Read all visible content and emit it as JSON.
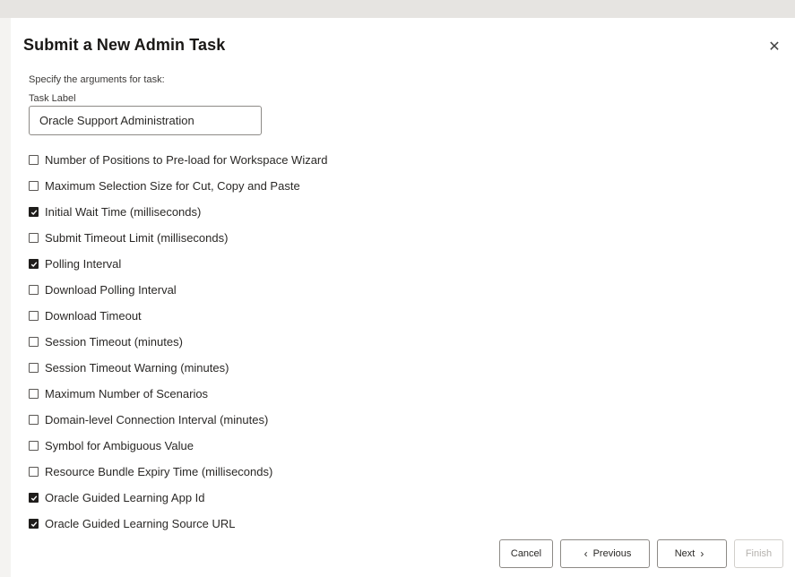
{
  "dialog": {
    "title": "Submit a New Admin Task",
    "close_icon": "close-icon",
    "instructions": "Specify the arguments for task:",
    "task_label": {
      "label": "Task Label",
      "value": "Oracle Support Administration"
    }
  },
  "options": [
    {
      "label": "Number of Positions to Pre-load for Workspace Wizard",
      "checked": false
    },
    {
      "label": "Maximum Selection Size for Cut, Copy and Paste",
      "checked": false
    },
    {
      "label": "Initial Wait Time (milliseconds)",
      "checked": true
    },
    {
      "label": "Submit Timeout Limit (milliseconds)",
      "checked": false
    },
    {
      "label": "Polling Interval",
      "checked": true
    },
    {
      "label": "Download Polling Interval",
      "checked": false
    },
    {
      "label": "Download Timeout",
      "checked": false
    },
    {
      "label": "Session Timeout (minutes)",
      "checked": false
    },
    {
      "label": "Session Timeout Warning (minutes)",
      "checked": false
    },
    {
      "label": "Maximum Number of Scenarios",
      "checked": false
    },
    {
      "label": "Domain-level Connection Interval (minutes)",
      "checked": false
    },
    {
      "label": "Symbol for Ambiguous Value",
      "checked": false
    },
    {
      "label": "Resource Bundle Expiry Time (milliseconds)",
      "checked": false
    },
    {
      "label": "Oracle Guided Learning App Id",
      "checked": true
    },
    {
      "label": "Oracle Guided Learning Source URL",
      "checked": true
    }
  ],
  "footer": {
    "cancel": "Cancel",
    "previous": "Previous",
    "next": "Next",
    "finish": "Finish",
    "finish_disabled": true
  }
}
